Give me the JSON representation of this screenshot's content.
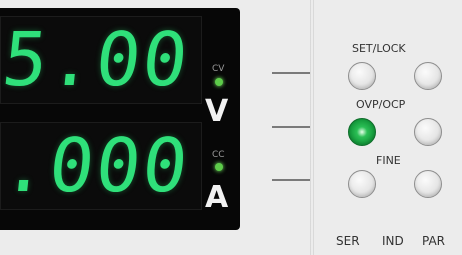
{
  "display": {
    "voltage": "5.00",
    "current": ".000",
    "cv_label": "CV",
    "cc_label": "CC",
    "voltage_unit": "V",
    "current_unit": "A",
    "digit_color": "#2fe07a"
  },
  "controls": {
    "set_lock_label": "SET/LOCK",
    "ovp_ocp_label": "OVP/OCP",
    "fine_label": "FINE",
    "mode_labels": [
      "SER",
      "IND",
      "PAR"
    ]
  },
  "state": {
    "ovp_ocp_led_lit": true,
    "led_color": "#2bbf55"
  }
}
